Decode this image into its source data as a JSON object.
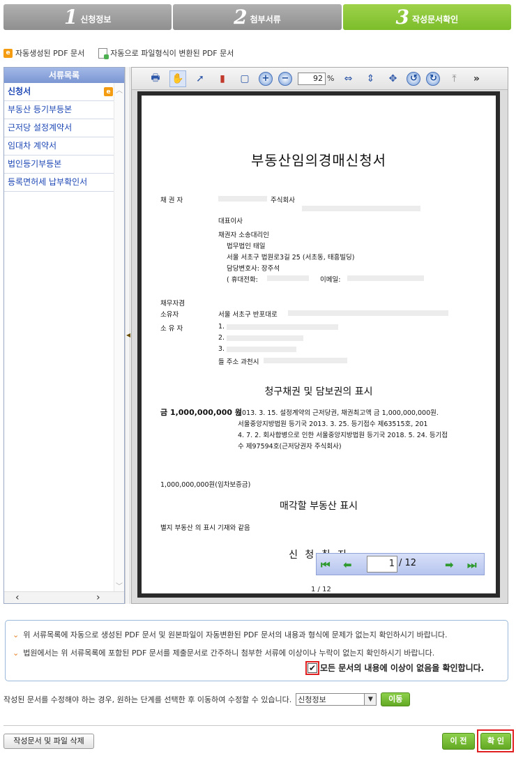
{
  "steps": [
    {
      "num": "1",
      "label": "신청정보"
    },
    {
      "num": "2",
      "label": "첨부서류"
    },
    {
      "num": "3",
      "label": "작성문서확인"
    }
  ],
  "legend": {
    "auto_pdf": "자동생성된 PDF 문서",
    "converted_pdf": "자동으로 파일형식이 변환된 PDF 문서"
  },
  "doclist": {
    "title": "서류목록",
    "items": [
      "신청서",
      "부동산 등기부등본",
      "근저당 설정계약서",
      "임대차 계약서",
      "법인등기부등본",
      "등록면허세 납부확인서"
    ]
  },
  "viewer": {
    "zoom": "92",
    "zoom_unit": "%",
    "current_page": "1",
    "total_pages": "/ 12",
    "page_count_label": "1 / 12"
  },
  "document": {
    "title": "부동산임의경매신청서",
    "creditor_label": "채 권 자",
    "creditor_company": "주식회사",
    "rep": "대표이사",
    "agent_label": "채권자 소송대리인",
    "law_firm": "법무법인 태일",
    "address": "서울 서초구 법원로3길 25 (서초동, 태흥빌딩)",
    "lawyer": "담당변호사: 장주석",
    "contact": "(   휴대전화:",
    "email": "이메일:",
    "debtor_label": "채무자겸",
    "owner_label": "소유자",
    "owner_addr": "서울 서초구 반포대로",
    "owner2_label": "소 유 자",
    "owner2_1": "1.",
    "owner2_2": "2.",
    "owner2_3": "3.",
    "owner2_4": "들 주소 과천시",
    "claim_title": "청구채권 및 담보권의 표시",
    "amount": "금  1,000,000,000 원",
    "claim_line1": "2013. 3. 15. 설정계약의 근저당권, 채권최고액 금 1,000,000,000원.",
    "claim_line2": "서울중앙지방법원 등기국 2013. 3. 25. 등기접수 제63515호, 201",
    "claim_line3": "4. 7. 2. 회사합병으로 인한 서울중앙지방법원 등기국 2018. 5. 24. 등기접",
    "claim_line4": "수 제97594호(근저당권자                    주식회사)",
    "deposit": "1,000,000,000원(임차보증금)",
    "property_title": "매각할 부동산 표시",
    "property_text": "별지 부동산 의 표시 기재와 같음",
    "purpose_title": "신 청 취 지"
  },
  "confirm": {
    "line1": "위 서류목록에 자동으로 생성된 PDF 문서 및 원본파일이 자동변환된 PDF 문서의 내용과 형식에 문제가 없는지 확인하시기 바랍니다.",
    "line2": "법원에서는 위 서류목록에 포함된 PDF 문서를 제출문서로 간주하니 첨부한 서류에 이상이나 누락이 없는지 확인하시기 바랍니다.",
    "check_label": "모든 문서의 내용에 이상이 없음을 확인합니다."
  },
  "modify": {
    "text": "작성된 문서를 수정해야 하는 경우, 원하는 단계를 선택한 후 이동하여 수정할 수 있습니다.",
    "select_value": "신청정보",
    "move_label": "이동"
  },
  "footer": {
    "delete_label": "작성문서 및 파일 삭제",
    "prev_label": "이 전",
    "ok_label": "확 인"
  }
}
